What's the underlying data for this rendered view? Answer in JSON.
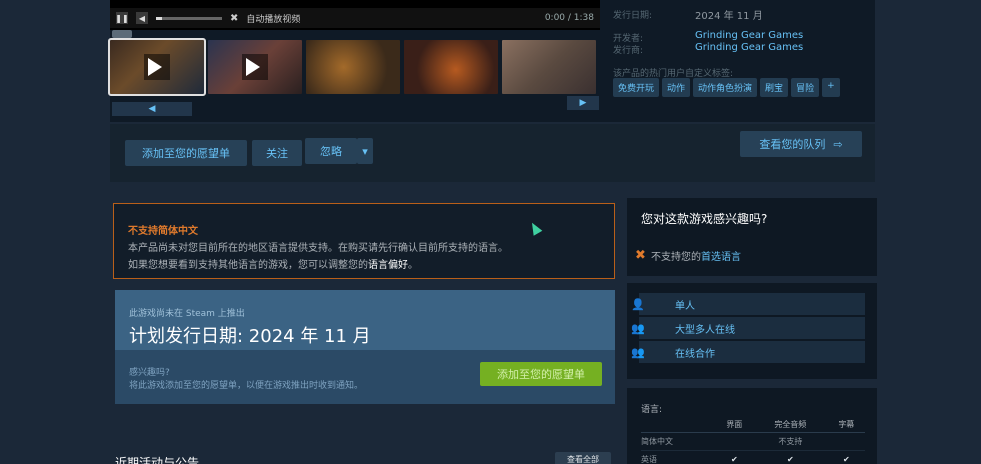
{
  "video": {
    "auto_play_label": "自动播放视频",
    "time": "0:00 / 1:38"
  },
  "info": {
    "release_label": "发行日期:",
    "release_value": "2024 年 11 月",
    "developer_label": "开发者:",
    "developer_value": "Grinding Gear Games",
    "publisher_label": "发行商:",
    "publisher_value": "Grinding Gear Games",
    "tags_label": "该产品的热门用户自定义标签:",
    "tags": [
      "免费开玩",
      "动作",
      "动作角色扮演",
      "刷宝",
      "冒险",
      "+"
    ]
  },
  "actions": {
    "wishlist": "添加至您的愿望单",
    "follow": "关注",
    "ignore": "忽略",
    "queue": "查看您的队列"
  },
  "notice": {
    "title": "不支持简体中文",
    "line1": "本产品尚未对您目前所在的地区语言提供支持。在购买请先行确认目前所支持的语言。",
    "line2_prefix": "如果您想要看到支持其他语言的游戏，您可以调整您的",
    "line2_link": "语言偏好",
    "line2_suffix": "。"
  },
  "release_box": {
    "subtitle": "此游戏尚未在 Steam 上推出",
    "date": "计划发行日期: 2024 年 11 月",
    "question": "感兴趣吗?",
    "desc": "将此游戏添加至您的愿望单，以便在游戏推出时收到通知。",
    "wishlist": "添加至您的愿望单"
  },
  "interest": {
    "title": "您对这款游戏感兴趣吗?",
    "unsupported_prefix": "不支持您的",
    "unsupported_link": "首选语言"
  },
  "features": [
    {
      "icon": "single-player-icon",
      "label": "单人"
    },
    {
      "icon": "mmo-icon",
      "label": "大型多人在线"
    },
    {
      "icon": "online-coop-icon",
      "label": "在线合作"
    }
  ],
  "languages": {
    "title": "语言:",
    "headers": [
      "",
      "界面",
      "完全音频",
      "字幕"
    ],
    "rows": [
      {
        "name": "简体中文",
        "note": "不支持"
      },
      {
        "name": "英语",
        "ui": "✔",
        "audio": "✔",
        "sub": "✔"
      }
    ]
  },
  "recent": {
    "title": "近期活动与公告",
    "view_all": "查看全部"
  }
}
